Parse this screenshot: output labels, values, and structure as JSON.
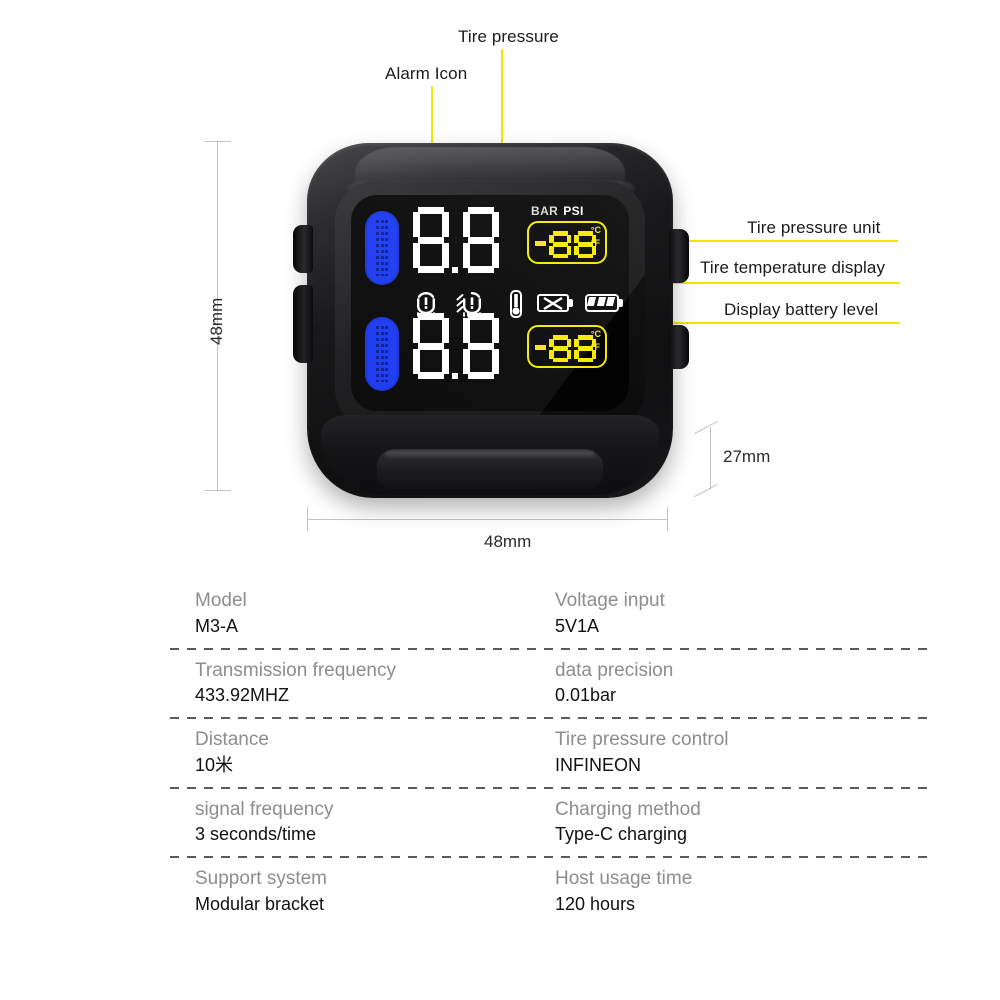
{
  "callouts": [
    {
      "id": "alarm-icon",
      "label": "Alarm Icon"
    },
    {
      "id": "tire-pressure",
      "label": "Tire pressure"
    },
    {
      "id": "tire-pressure-unit",
      "label": "Tire pressure unit"
    },
    {
      "id": "tire-temperature",
      "label": "Tire temperature display"
    },
    {
      "id": "display-battery-level",
      "label": "Display battery level"
    }
  ],
  "dimensions": {
    "height": "48mm",
    "width": "48mm",
    "depth": "27mm"
  },
  "device": {
    "lcd": {
      "unit_bar": "BAR",
      "unit_psi": "PSI",
      "pressure_top": "88",
      "pressure_bottom": "88",
      "temp_top": "88",
      "temp_bottom": "88",
      "temp_unit_c": "°C",
      "temp_unit_f": "°F",
      "icons": [
        "tire-pressure-warning-icon",
        "tire-leak-warning-icon",
        "thermometer-icon",
        "sensor-battery-empty-icon",
        "battery-level-icon"
      ]
    },
    "colors": {
      "lcd_background": "#030303",
      "digit_white": "#ffffff",
      "temp_yellow": "#f5e800",
      "tire_blue": "#1636f0",
      "leader_yellow": "#f2e500"
    }
  },
  "spec_table": {
    "rows": [
      {
        "left": {
          "label": "Model",
          "value": "M3-A"
        },
        "right": {
          "label": "Voltage input",
          "value": "5V1A"
        }
      },
      {
        "left": {
          "label": "Transmission frequency",
          "value": "433.92MHZ"
        },
        "right": {
          "label": "data precision",
          "value": "0.01bar"
        }
      },
      {
        "left": {
          "label": "Distance",
          "value": "10米"
        },
        "right": {
          "label": "Tire pressure control",
          "value": "INFINEON"
        }
      },
      {
        "left": {
          "label": "signal frequency",
          "value": "3 seconds/time"
        },
        "right": {
          "label": "Charging method",
          "value": "Type-C charging"
        }
      },
      {
        "left": {
          "label": "Support system",
          "value": "Modular bracket"
        },
        "right": {
          "label": "Host usage time",
          "value": "120 hours"
        }
      }
    ]
  }
}
